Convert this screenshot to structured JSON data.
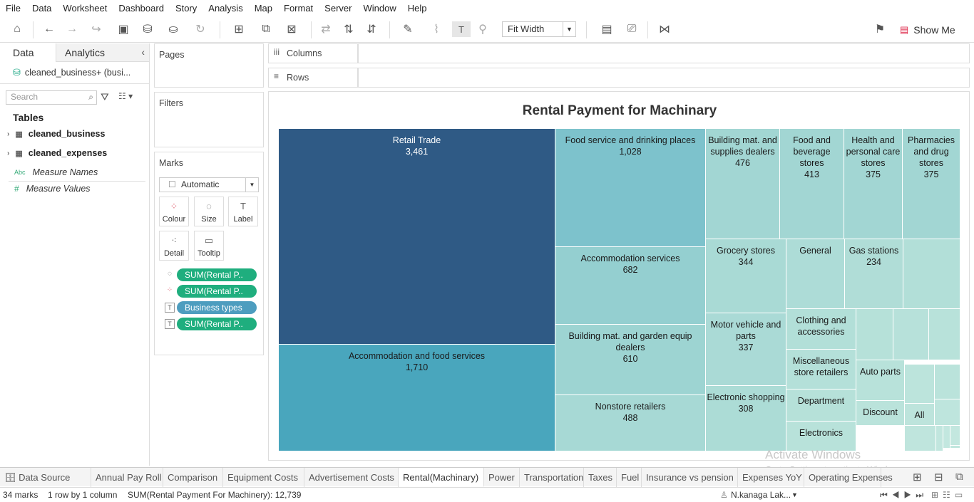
{
  "menu": [
    "File",
    "Data",
    "Worksheet",
    "Dashboard",
    "Story",
    "Analysis",
    "Map",
    "Format",
    "Server",
    "Window",
    "Help"
  ],
  "toolbar": {
    "fit": "Fit Width",
    "show_me": "Show Me"
  },
  "left_pane": {
    "tabs": [
      "Data",
      "Analytics"
    ],
    "data_source": "cleaned_business+ (busi...",
    "search_placeholder": "Search",
    "tables_header": "Tables",
    "tables": [
      "cleaned_business",
      "cleaned_expenses"
    ],
    "measures": [
      {
        "prefix": "Abc",
        "name": "Measure Names"
      },
      {
        "prefix": "#",
        "name": "Measure Values"
      }
    ]
  },
  "cards": {
    "pages": "Pages",
    "filters": "Filters",
    "marks": "Marks",
    "mark_type": "Automatic",
    "mark_buttons": [
      "Colour",
      "Size",
      "Label",
      "Detail",
      "Tooltip"
    ],
    "pills": [
      {
        "label": "SUM(Rental P..",
        "color": "#1fae7e"
      },
      {
        "label": "SUM(Rental P..",
        "color": "#1fae7e"
      },
      {
        "label": "Business types",
        "color": "#4d9dbf"
      },
      {
        "label": "SUM(Rental P..",
        "color": "#1fae7e"
      }
    ]
  },
  "shelves": {
    "columns": "Columns",
    "rows": "Rows"
  },
  "viz": {
    "title": "Rental Payment for Machinary",
    "cells": [
      {
        "label": "Retail Trade",
        "value": "3,461",
        "color": "#2f5a85",
        "text": "#ffffff"
      },
      {
        "label": "Accommodation and food services",
        "value": "1,710",
        "color": "#49a6bd",
        "text": "#1a1a1a"
      },
      {
        "label": "Food service and drinking places",
        "value": "1,028",
        "color": "#7dc2cc",
        "text": "#1a1a1a"
      },
      {
        "label": "Accommodation services",
        "value": "682",
        "color": "#94cfd0",
        "text": "#1a1a1a"
      },
      {
        "label": "Building mat. and garden equip dealers",
        "value": "610",
        "color": "#9dd4d2",
        "text": "#1a1a1a"
      },
      {
        "label": "Nonstore retailers",
        "value": "488",
        "color": "#a7d9d5",
        "text": "#1a1a1a"
      },
      {
        "label": "Building mat. and supplies dealers",
        "value": "476",
        "color": "#a2d6d3",
        "text": "#1a1a1a"
      },
      {
        "label": "Food and beverage stores",
        "value": "413",
        "color": "#a2d6d3",
        "text": "#1a1a1a"
      },
      {
        "label": "Health and personal care stores",
        "value": "375",
        "color": "#a2d6d3",
        "text": "#1a1a1a"
      },
      {
        "label": "Pharmacies and drug stores",
        "value": "375",
        "color": "#a2d6d3",
        "text": "#1a1a1a"
      },
      {
        "label": "Grocery stores",
        "value": "344",
        "color": "#a9dad5",
        "text": "#1a1a1a"
      },
      {
        "label": "Motor vehicle and parts",
        "value": "337",
        "color": "#aadad6",
        "text": "#1a1a1a"
      },
      {
        "label": "Electronic shopping",
        "value": "308",
        "color": "#acdcd6",
        "text": "#1a1a1a"
      },
      {
        "label": "General",
        "value": "",
        "color": "#addcd7",
        "text": "#1a1a1a"
      },
      {
        "label": "Gas stations",
        "value": "234",
        "color": "#b0ddd7",
        "text": "#1a1a1a"
      },
      {
        "label": "Clothing and accessories",
        "value": "",
        "color": "#b2dfd8",
        "text": "#1a1a1a"
      },
      {
        "label": "Miscellaneous store retailers",
        "value": "",
        "color": "#b4e0d9",
        "text": "#1a1a1a"
      },
      {
        "label": "Department",
        "value": "",
        "color": "#b6e1d9",
        "text": "#1a1a1a"
      },
      {
        "label": "Electronics",
        "value": "",
        "color": "#b8e2da",
        "text": "#1a1a1a"
      },
      {
        "label": "Auto parts",
        "value": "",
        "color": "#b8e2da",
        "text": "#1a1a1a"
      },
      {
        "label": "Discount",
        "value": "",
        "color": "#bae3db",
        "text": "#1a1a1a"
      },
      {
        "label": "All",
        "value": "",
        "color": "#bde4dc",
        "text": "#1a1a1a"
      },
      {
        "label": "",
        "value": "",
        "color": "#b2dfd8",
        "text": "#1a1a1a"
      },
      {
        "label": "",
        "value": "",
        "color": "#b6e1d9",
        "text": "#1a1a1a"
      },
      {
        "label": "",
        "value": "",
        "color": "#b7e1da",
        "text": "#1a1a1a"
      },
      {
        "label": "",
        "value": "",
        "color": "#b8e2da",
        "text": "#1a1a1a"
      },
      {
        "label": "",
        "value": "",
        "color": "#bae3db",
        "text": "#1a1a1a"
      },
      {
        "label": "",
        "value": "",
        "color": "#bce4dc",
        "text": "#1a1a1a"
      },
      {
        "label": "",
        "value": "",
        "color": "#bee5dd",
        "text": "#1a1a1a"
      },
      {
        "label": "",
        "value": "",
        "color": "#bfe5dd",
        "text": "#1a1a1a"
      },
      {
        "label": "",
        "value": "",
        "color": "#c0e6de",
        "text": "#1a1a1a"
      },
      {
        "label": "",
        "value": "",
        "color": "#c1e6de",
        "text": "#1a1a1a"
      },
      {
        "label": "",
        "value": "",
        "color": "#c2e7df",
        "text": "#1a1a1a"
      },
      {
        "label": "",
        "value": "",
        "color": "#c3e7df",
        "text": "#1a1a1a"
      }
    ],
    "watermark": "Activate Windows",
    "watermark_sub": "Go to Settings to activate Windows."
  },
  "sheet_tabs": [
    "Data Source",
    "Annual Pay Roll",
    "Comparison",
    "Equipment Costs",
    "Advertisement Costs",
    "Rental(Machinary)",
    "Power",
    "Transportation",
    "Taxes",
    "Fuel",
    "Insurance vs pension",
    "Expenses YoY",
    "Operating Expenses"
  ],
  "active_tab": "Rental(Machinary)",
  "status": {
    "marks": "34 marks",
    "dims": "1 row  by  1 column",
    "sum": "SUM(Rental Payment For Machinery): 12,739",
    "user": "N.kanaga Lak..."
  }
}
